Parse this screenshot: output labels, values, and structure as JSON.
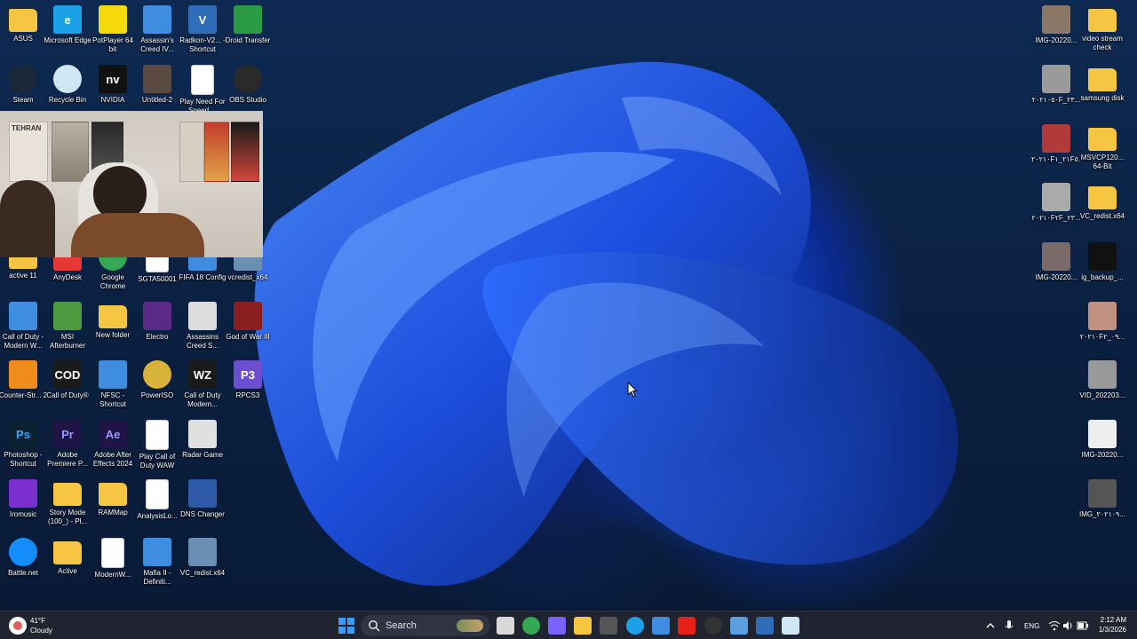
{
  "colors": {
    "taskbar_bg": "#1f2430",
    "accent": "#2c72ff"
  },
  "desktop": {
    "icons_left": [
      {
        "label": "ASUS",
        "icon": "folder-icon",
        "color": "#f6c542"
      },
      {
        "label": "Microsoft Edge",
        "icon": "edge-icon",
        "color": "#1aa1e8"
      },
      {
        "label": "PotPlayer 64 bit",
        "icon": "potplayer-icon",
        "color": "#f5d90a"
      },
      {
        "label": "Assassin's Creed IV...",
        "icon": "app-window-icon",
        "color": "#3f8de0"
      },
      {
        "label": "Radkon-V2... - Shortcut",
        "icon": "radkon-icon",
        "color": "#2f6db8"
      },
      {
        "label": "Droid Transfer",
        "icon": "droid-transfer-icon",
        "color": "#2b9a45"
      },
      {
        "label": "Steam",
        "icon": "steam-icon",
        "color": "#1b2838"
      },
      {
        "label": "Recycle Bin",
        "icon": "recycle-bin-icon",
        "color": "#cfe6f5"
      },
      {
        "label": "NVIDIA",
        "icon": "nvidia-icon",
        "color": "#111111"
      },
      {
        "label": "Untitled-2",
        "icon": "image-file-icon",
        "color": "#5a4a42"
      },
      {
        "label": "Play Need For Speed ...",
        "icon": "document-icon",
        "color": "#ffffff"
      },
      {
        "label": "OBS Studio",
        "icon": "obs-icon",
        "color": "#2a2a2a"
      },
      {
        "label": "active 11",
        "icon": "folder-icon",
        "color": "#f6c542"
      },
      {
        "label": "AnyDesk",
        "icon": "anydesk-icon",
        "color": "#e53935"
      },
      {
        "label": "Google Chrome",
        "icon": "chrome-icon",
        "color": "#34a853"
      },
      {
        "label": "SGTA50001",
        "icon": "document-icon",
        "color": "#ffffff"
      },
      {
        "label": "FIFA 18 Config",
        "icon": "app-window-icon",
        "color": "#3f8de0"
      },
      {
        "label": "vcredist_x64",
        "icon": "installer-icon",
        "color": "#6a8fb3"
      },
      {
        "label": "Call of Duty - Modern W...",
        "icon": "app-window-icon",
        "color": "#3f8de0"
      },
      {
        "label": "MSI Afterburner",
        "icon": "msi-icon",
        "color": "#4c9a3f"
      },
      {
        "label": "New folder",
        "icon": "folder-icon",
        "color": "#f6c542"
      },
      {
        "label": "Electro",
        "icon": "electro-icon",
        "color": "#5b2a86"
      },
      {
        "label": "Assassins Creed S...",
        "icon": "assassins-icon",
        "color": "#dddddd"
      },
      {
        "label": "God of War III",
        "icon": "god-of-war-icon",
        "color": "#8a1f1f"
      },
      {
        "label": "Counter-Str... 2",
        "icon": "counter-strike-icon",
        "color": "#f08c1a"
      },
      {
        "label": "Call of Duty®",
        "icon": "call-of-duty-icon",
        "color": "#1a1a1a"
      },
      {
        "label": "NFSC - Shortcut",
        "icon": "app-window-icon",
        "color": "#3f8de0"
      },
      {
        "label": "PowerISO",
        "icon": "poweriso-icon",
        "color": "#d9b23a"
      },
      {
        "label": "Call of Duty Modern...",
        "icon": "warzone-icon",
        "color": "#1a1a1a"
      },
      {
        "label": "RPCS3",
        "icon": "rpcs3-icon",
        "color": "#6b4fd1"
      },
      {
        "label": "Photoshop - Shortcut",
        "icon": "photoshop-icon",
        "color": "#0b2233"
      },
      {
        "label": "Adobe Premiere P...",
        "icon": "premiere-icon",
        "color": "#1f1446"
      },
      {
        "label": "Adobe After Effects 2024",
        "icon": "after-effects-icon",
        "color": "#1f1446"
      },
      {
        "label": "Play Call of Duty WAW",
        "icon": "document-icon",
        "color": "#ffffff"
      },
      {
        "label": "Radar Game",
        "icon": "radar-icon",
        "color": "#e0e0e0"
      },
      {
        "label": "Iromusic",
        "icon": "iromusic-icon",
        "color": "#7b2fd1"
      },
      {
        "label": "Story Mode (100_) - Pl...",
        "icon": "folder-icon",
        "color": "#f6c542"
      },
      {
        "label": "RAMMap",
        "icon": "folder-icon",
        "color": "#f6c542"
      },
      {
        "label": "AnalysisLo...",
        "icon": "document-icon",
        "color": "#ffffff"
      },
      {
        "label": "DNS Changer",
        "icon": "dns-changer-icon",
        "color": "#2e5aa8"
      },
      {
        "label": "Battle.net",
        "icon": "battlenet-icon",
        "color": "#148eff"
      },
      {
        "label": "Active",
        "icon": "folder-icon",
        "color": "#f6c542"
      },
      {
        "label": "ModernW...",
        "icon": "document-icon",
        "color": "#ffffff"
      },
      {
        "label": "Mafia II - Definiti...",
        "icon": "app-window-icon",
        "color": "#3f8de0"
      },
      {
        "label": "VC_redist.x64",
        "icon": "installer-icon",
        "color": "#6a8fb3"
      }
    ],
    "icons_right": [
      {
        "label": "IMG-20220...",
        "icon": "photo-icon",
        "color": "#8a7766"
      },
      {
        "label": "video stream check",
        "icon": "folder-icon",
        "color": "#f6c542"
      },
      {
        "label": "٢٠٢١٠٥٠F_٢٣...",
        "icon": "photo-icon",
        "color": "#9a9a9a"
      },
      {
        "label": "samsung disk",
        "icon": "folder-icon",
        "color": "#f6c542"
      },
      {
        "label": "٢٠٢١٠F٢١_١F٥...",
        "icon": "photo-icon",
        "color": "#b33a3a"
      },
      {
        "label": "MSVCP120... 64-Bit",
        "icon": "folder-icon",
        "color": "#f6c542"
      },
      {
        "label": "٢٠٢١٠F٢F_٢٣...",
        "icon": "video-icon",
        "color": "#aaaaaa"
      },
      {
        "label": "VC_redist.x64",
        "icon": "folder-icon",
        "color": "#f6c542"
      },
      {
        "label": "IMG-20220...",
        "icon": "photo-icon",
        "color": "#7a6a6a"
      },
      {
        "label": "ig_backup_...",
        "icon": "dark-file-icon",
        "color": "#111111"
      },
      {
        "label": "٢٠٢١٠F٠٩_٢...",
        "icon": "photo-icon",
        "color": "#c09080"
      },
      {
        "label": "VID_202203...",
        "icon": "video-icon",
        "color": "#999999"
      },
      {
        "label": "IMG-20220...",
        "icon": "photo-icon",
        "color": "#eeeeee"
      },
      {
        "label": "IMG_٢٠٢١٠٩...",
        "icon": "photo-icon",
        "color": "#555555"
      }
    ]
  },
  "webcam": {
    "poster_text": "TEHRAN"
  },
  "taskbar": {
    "weather": {
      "temp": "41°F",
      "condition": "Cloudy"
    },
    "search_label": "Search",
    "language": "ENG",
    "time": "2:12 AM",
    "date": "1/3/2026",
    "pinned": [
      {
        "name": "task-view-icon",
        "color": "#d8d8d8"
      },
      {
        "name": "chrome-icon",
        "color": "#34a853"
      },
      {
        "name": "copilot-icon",
        "color": "#7b61ff"
      },
      {
        "name": "file-explorer-icon",
        "color": "#f6c542"
      },
      {
        "name": "pin-icon",
        "color": "#555555"
      },
      {
        "name": "edge-icon",
        "color": "#1aa1e8"
      },
      {
        "name": "store-icon",
        "color": "#3f8de0"
      },
      {
        "name": "youtube-icon",
        "color": "#e62117"
      },
      {
        "name": "obs-icon",
        "color": "#333333"
      },
      {
        "name": "monitor-icon",
        "color": "#5aa0e0"
      },
      {
        "name": "radkon-icon",
        "color": "#2f6db8"
      },
      {
        "name": "window-icon",
        "color": "#cfe6f5"
      }
    ]
  }
}
